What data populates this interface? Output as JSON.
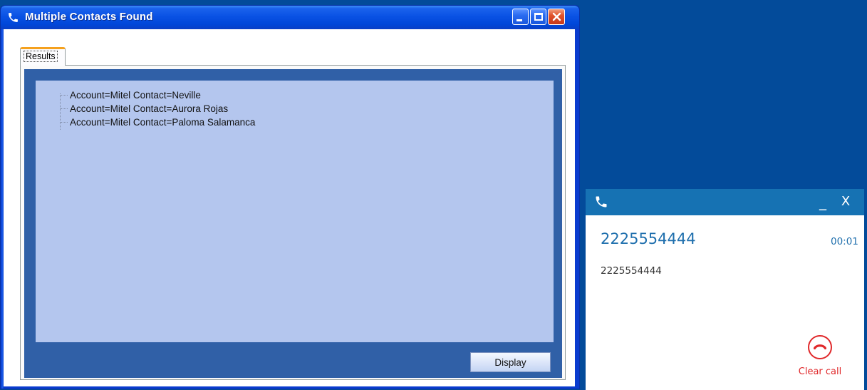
{
  "window": {
    "title": "Multiple Contacts Found",
    "tab_label": "Results",
    "results": [
      "Account=Mitel  Contact=Neville",
      "Account=Mitel  Contact=Aurora Rojas",
      "Account=Mitel  Contact=Paloma Salamanca"
    ],
    "display_label": "Display"
  },
  "call_toast": {
    "minimize_glyph": "_",
    "close_glyph": "X",
    "number": "2225554444",
    "timer": "00:01",
    "caller": "2225554444",
    "clear_label": "Clear call"
  },
  "colors": {
    "desktop": "#034b9a",
    "toast_header": "#1672b3",
    "accent_text": "#1f6fad",
    "clear_call": "#e0282a",
    "tree_background": "#b4c6ee",
    "panel_background": "#3060a7"
  },
  "icons": {
    "window_icon": "phone-icon",
    "toast_icon": "phone-icon",
    "clear_icon": "hang-up-icon"
  }
}
